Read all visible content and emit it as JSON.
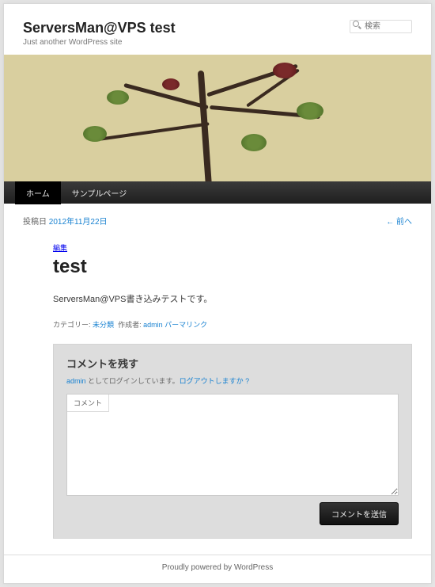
{
  "site": {
    "title": "ServersMan@VPS test",
    "tagline": "Just another WordPress site"
  },
  "search": {
    "placeholder": "検索"
  },
  "nav": {
    "items": [
      "ホーム",
      "サンプルページ"
    ],
    "current": 0
  },
  "navAbove": {
    "postedOnLabel": "投稿日",
    "date": "2012年11月22日",
    "prev": "← 前へ"
  },
  "post": {
    "editLabel": "編集",
    "title": "test",
    "content": "ServersMan@VPS書き込みテストです。",
    "meta": {
      "catLabel": "カテゴリー:",
      "category": "未分類",
      "authorLabel": "作成者:",
      "author": "admin",
      "permalink": "パーマリンク"
    }
  },
  "respond": {
    "title": "コメントを残す",
    "loggedInAs1": " としてログインしています。",
    "loggedInUser": "admin",
    "logout": "ログアウトしますか ?",
    "commentLabel": "コメント",
    "submit": "コメントを送信"
  },
  "footer": {
    "text": "Proudly powered by WordPress"
  }
}
